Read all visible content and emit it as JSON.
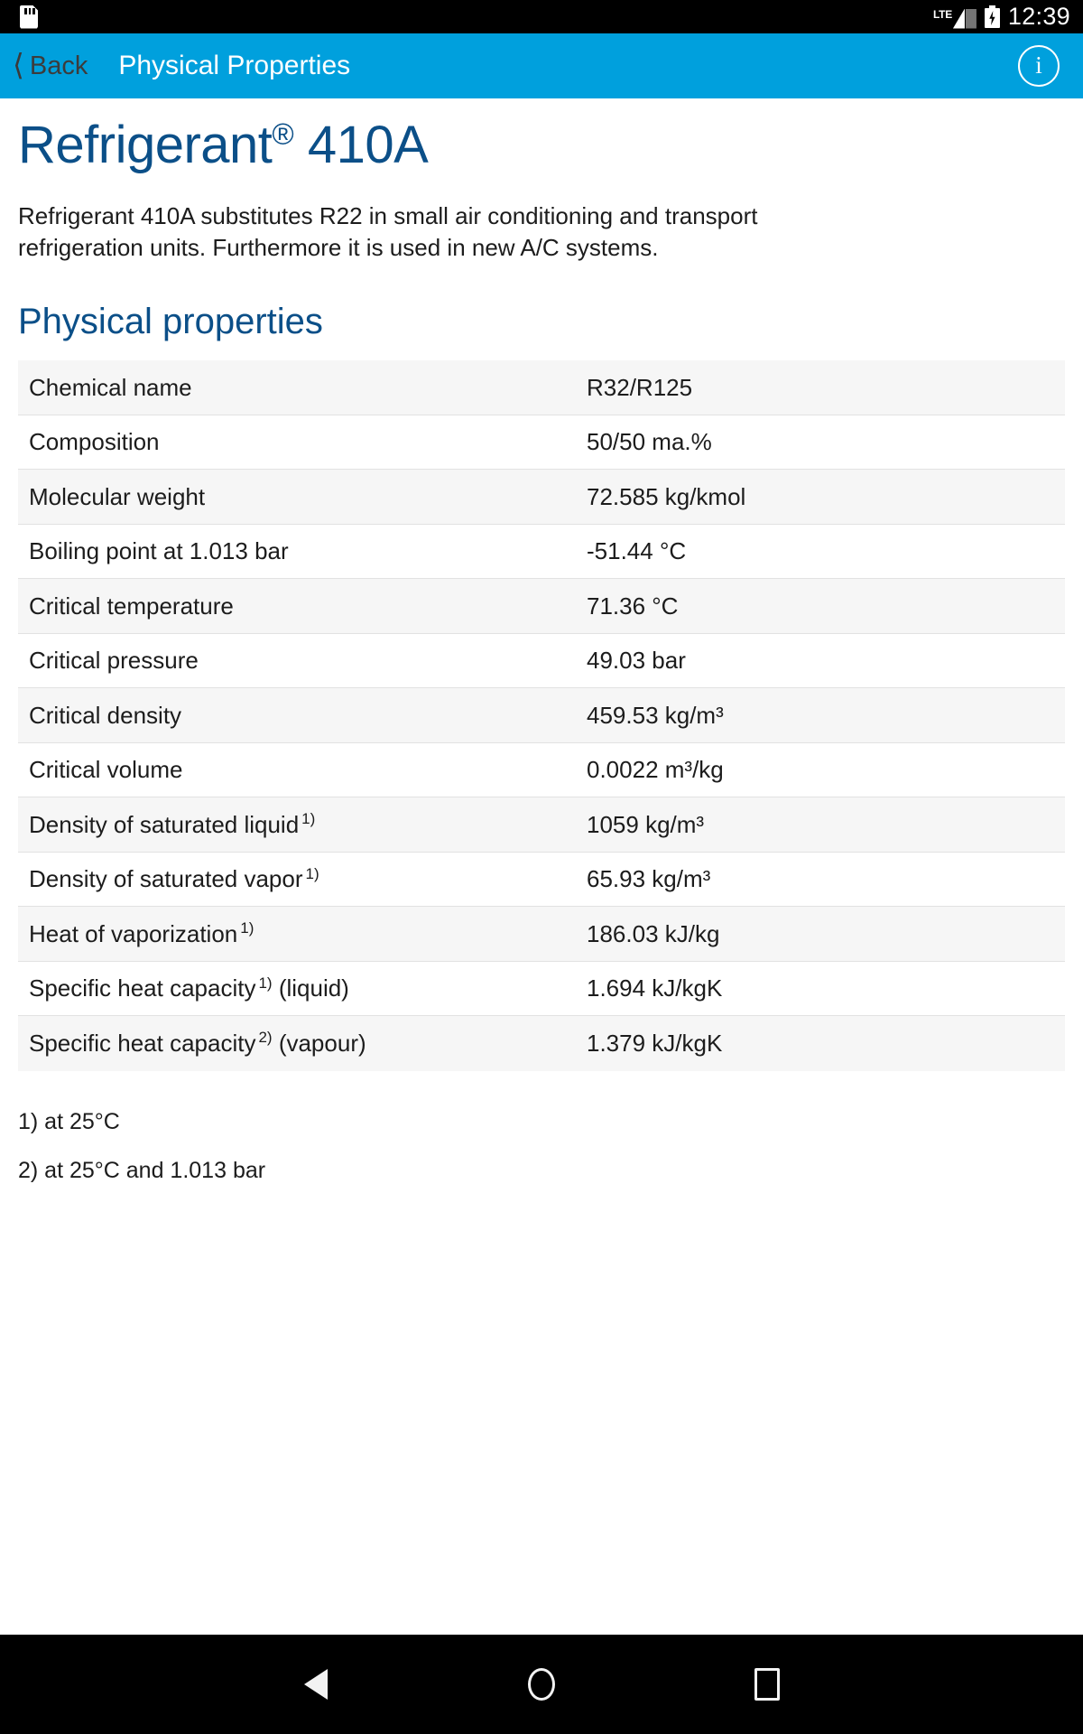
{
  "status_bar": {
    "sd_card_icon": "sd-card-icon",
    "network_label": "LTE",
    "signal_icon": "signal-bars-icon",
    "battery_icon": "battery-charging-icon",
    "time": "12:39"
  },
  "app_bar": {
    "back_label": "Back",
    "back_icon": "chevron-left-icon",
    "title": "Physical Properties",
    "info_icon": "info-icon",
    "info_glyph": "i",
    "background_color": "#00a0dd"
  },
  "page": {
    "title_main": "Refrigerant",
    "title_sup": "®",
    "title_suffix": " 410A",
    "title_color": "#0b4f88",
    "description": "Refrigerant 410A substitutes R22 in small air conditioning and transport refrigeration units. Furthermore it is used in new A/C systems.",
    "section_title": "Physical properties"
  },
  "properties": [
    {
      "key": "Chemical name",
      "sup": "",
      "key_suffix": "",
      "value": "R32/R125",
      "value_sup": ""
    },
    {
      "key": "Composition",
      "sup": "",
      "key_suffix": "",
      "value": "50/50 ma.%",
      "value_sup": ""
    },
    {
      "key": "Molecular weight",
      "sup": "",
      "key_suffix": "",
      "value": "72.585 kg/kmol",
      "value_sup": ""
    },
    {
      "key": "Boiling point at 1.013 bar",
      "sup": "",
      "key_suffix": "",
      "value": "-51.44 °C",
      "value_sup": ""
    },
    {
      "key": "Critical temperature",
      "sup": "",
      "key_suffix": "",
      "value": "71.36 °C",
      "value_sup": ""
    },
    {
      "key": "Critical pressure",
      "sup": "",
      "key_suffix": "",
      "value": "49.03 bar",
      "value_sup": ""
    },
    {
      "key": "Critical density",
      "sup": "",
      "key_suffix": "",
      "value": "459.53 kg/m³",
      "value_sup": ""
    },
    {
      "key": "Critical volume",
      "sup": "",
      "key_suffix": "",
      "value": "0.0022 m³/kg",
      "value_sup": ""
    },
    {
      "key": "Density of saturated liquid",
      "sup": "1)",
      "key_suffix": "",
      "value": "1059 kg/m³",
      "value_sup": ""
    },
    {
      "key": "Density of saturated vapor",
      "sup": "1)",
      "key_suffix": "",
      "value": "65.93 kg/m³",
      "value_sup": ""
    },
    {
      "key": "Heat of vaporization",
      "sup": "1)",
      "key_suffix": "",
      "value": "186.03 kJ/kg",
      "value_sup": ""
    },
    {
      "key": "Specific heat capacity",
      "sup": "1)",
      "key_suffix": " (liquid)",
      "value": "1.694 kJ/kgK",
      "value_sup": ""
    },
    {
      "key": "Specific heat capacity",
      "sup": "2)",
      "key_suffix": " (vapour)",
      "value": "1.379 kJ/kgK",
      "value_sup": ""
    }
  ],
  "footnotes": [
    "1) at 25°C",
    "2) at 25°C and 1.013 bar"
  ],
  "nav_bar": {
    "back_icon": "nav-back-triangle-icon",
    "home_icon": "nav-home-circle-icon",
    "recent_icon": "nav-recents-square-icon"
  }
}
